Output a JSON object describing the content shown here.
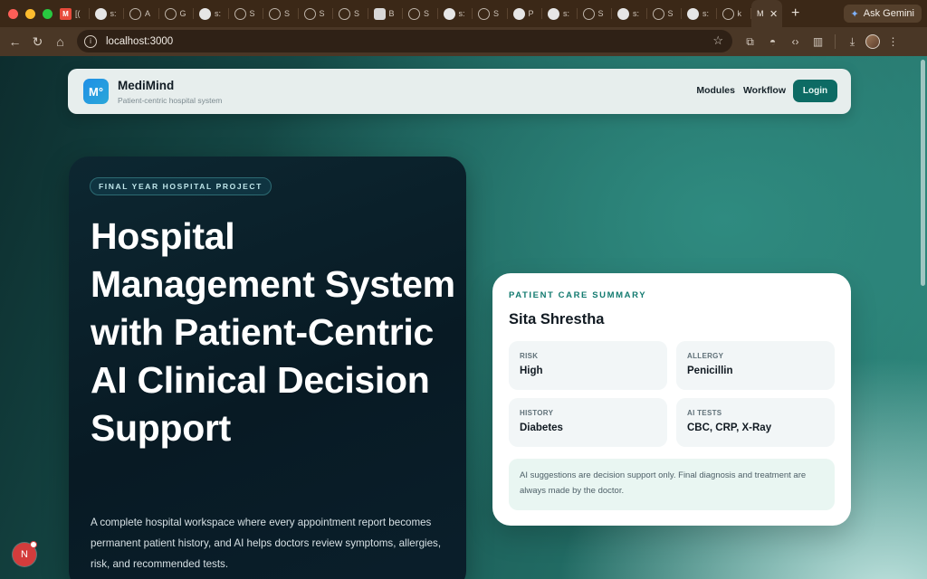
{
  "browser": {
    "tabs": [
      {
        "icon": "gmail-icon",
        "text": "[("
      },
      {
        "icon": "github-icon",
        "text": "s:"
      },
      {
        "icon": "globe-icon",
        "text": "A"
      },
      {
        "icon": "globe-icon",
        "text": "G"
      },
      {
        "icon": "github-icon",
        "text": "s:"
      },
      {
        "icon": "globe-icon",
        "text": "S"
      },
      {
        "icon": "globe-icon",
        "text": "S"
      },
      {
        "icon": "globe-icon",
        "text": "S"
      },
      {
        "icon": "globe-icon",
        "text": "S"
      },
      {
        "icon": "openai-icon",
        "text": "B"
      },
      {
        "icon": "globe-icon",
        "text": "S"
      },
      {
        "icon": "github-icon",
        "text": "s:"
      },
      {
        "icon": "globe-icon",
        "text": "S"
      },
      {
        "icon": "github-icon",
        "text": "P"
      },
      {
        "icon": "github-icon",
        "text": "s:"
      },
      {
        "icon": "globe-icon",
        "text": "S"
      },
      {
        "icon": "github-icon",
        "text": "s:"
      },
      {
        "icon": "globe-icon",
        "text": "S"
      },
      {
        "icon": "github-icon",
        "text": "s:"
      },
      {
        "icon": "globe-icon",
        "text": "k"
      }
    ],
    "active_tab": {
      "text": "M"
    },
    "ask_gemini": "Ask Gemini",
    "url": "localhost:3000",
    "colors": {
      "tabbar": "#3b2817",
      "toolbar": "#4a3726"
    }
  },
  "navbar": {
    "logo": "M°",
    "brand": "MediMind",
    "subtitle": "Patient-centric hospital system",
    "links": [
      "Modules",
      "Workflow"
    ],
    "login": "Login"
  },
  "hero": {
    "tag": "FINAL YEAR HOSPITAL PROJECT",
    "title": "Hospital Management System with Patient-Centric AI Clinical Decision Support",
    "description": "A complete hospital workspace where every appointment report becomes permanent patient history, and AI helps doctors review symptoms, allergies, risk, and recommended tests."
  },
  "summary_card": {
    "eyebrow": "PATIENT CARE SUMMARY",
    "patient_name": "Sita Shrestha",
    "tiles": [
      {
        "label": "RISK",
        "value": "High"
      },
      {
        "label": "ALLERGY",
        "value": "Penicillin"
      },
      {
        "label": "HISTORY",
        "value": "Diabetes"
      },
      {
        "label": "AI TESTS",
        "value": "CBC, CRP, X-Ray"
      }
    ],
    "disclaimer": "AI suggestions are decision support only. Final diagnosis and treatment are always made by the doctor."
  },
  "dev_badge": {
    "label": "N"
  },
  "colors": {
    "accent": "#0d6b64",
    "eyebrow": "#127a6f",
    "hero_bg": "#081a24"
  }
}
